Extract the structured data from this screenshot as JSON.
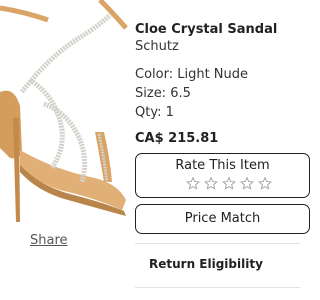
{
  "product": {
    "title": "Cloe Crystal Sandal",
    "brand": "Schutz",
    "color": "Color: Light Nude",
    "size": "Size: 6.5",
    "qty": "Qty: 1",
    "price": "CA$ 215.81"
  },
  "share_label": "Share",
  "rating": {
    "label": "Rate This Item",
    "star_count": 5,
    "star_icon": "star-outline-icon"
  },
  "price_match_label": "Price Match",
  "return_label": "Return Eligibility",
  "colors": {
    "text": "#222222",
    "star_outline": "#9a9a9a",
    "sandal_nude": "#d9a466",
    "crystal": "#d4d1cb"
  }
}
